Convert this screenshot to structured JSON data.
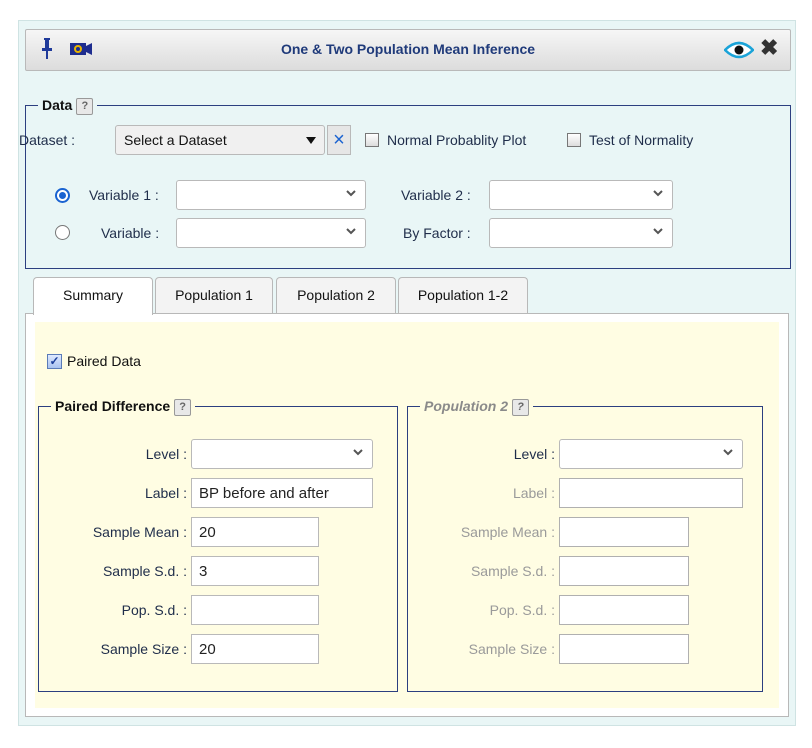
{
  "window": {
    "title": "One & Two Population Mean Inference",
    "icons": [
      "pin-icon",
      "camera-icon",
      "eye-icon",
      "close-icon"
    ]
  },
  "data_section": {
    "legend": "Data",
    "help": "?",
    "dataset_label": "Dataset :",
    "dataset_value": "Select a Dataset",
    "clear_icon": "×",
    "normal_plot_label": "Normal Probablity Plot",
    "normality_label": "Test of Normality",
    "variable1_label": "Variable 1 :",
    "variable2_label": "Variable 2 :",
    "variable_label": "Variable :",
    "by_factor_label": "By Factor :"
  },
  "tabs": [
    {
      "label": "Summary",
      "active": true
    },
    {
      "label": "Population 1",
      "active": false
    },
    {
      "label": "Population 2",
      "active": false
    },
    {
      "label": "Population 1-2",
      "active": false
    }
  ],
  "summary": {
    "paired_label": "Paired Data",
    "paired_checked": true,
    "left": {
      "legend": "Paired Difference",
      "help": "?",
      "level_label": "Level :",
      "label_label": "Label :",
      "label_value": "BP before and after",
      "mean_label": "Sample Mean :",
      "mean_value": "20",
      "sd_label": "Sample S.d. :",
      "sd_value": "3",
      "pop_sd_label": "Pop. S.d. :",
      "pop_sd_value": "",
      "size_label": "Sample Size :",
      "size_value": "20"
    },
    "right": {
      "legend": "Population 2",
      "help": "?",
      "level_label": "Level :",
      "label_label": "Label :",
      "mean_label": "Sample Mean :",
      "sd_label": "Sample S.d. :",
      "pop_sd_label": "Pop. S.d. :",
      "size_label": "Sample Size :"
    }
  },
  "colors": {
    "accent": "#1a63d1",
    "panel_bg": "#e9f6f6",
    "content_bg": "#fffde3",
    "border": "#2c3f80"
  }
}
